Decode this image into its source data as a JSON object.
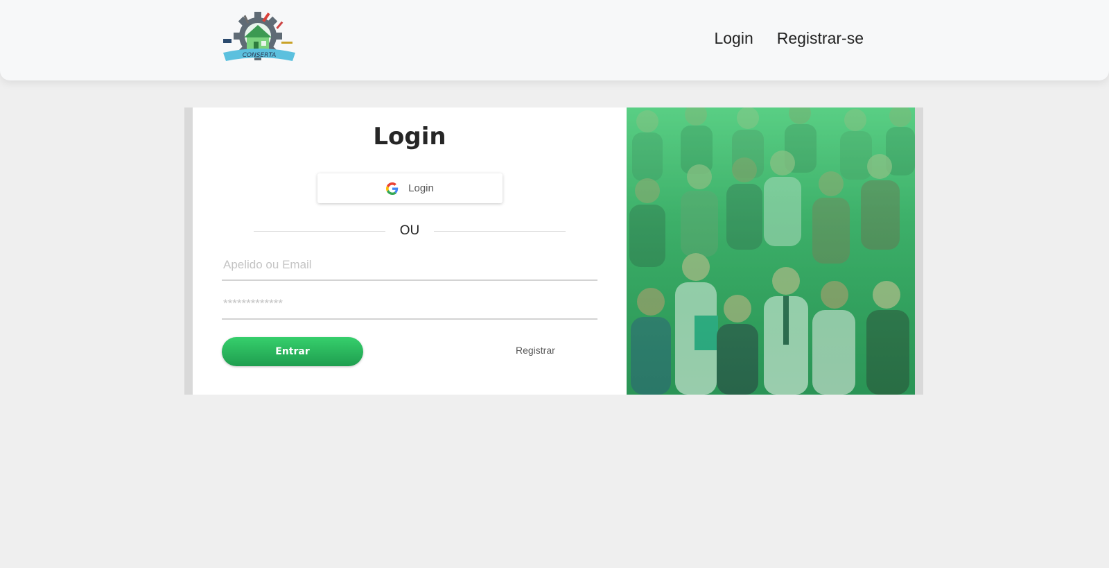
{
  "header": {
    "logo_text": "CONSERTA",
    "nav": [
      "Login",
      "Registrar-se"
    ]
  },
  "login": {
    "title": "Login",
    "google_button": {
      "icon": "google-icon",
      "label": "Login"
    },
    "divider": "OU",
    "username_placeholder": "Apelido ou Email",
    "password_placeholder": "*************",
    "submit_label": "Entrar",
    "register_link": "Registrar"
  },
  "colors": {
    "accent_green": "#2bb45d",
    "illustration_green": "#3aa866"
  }
}
